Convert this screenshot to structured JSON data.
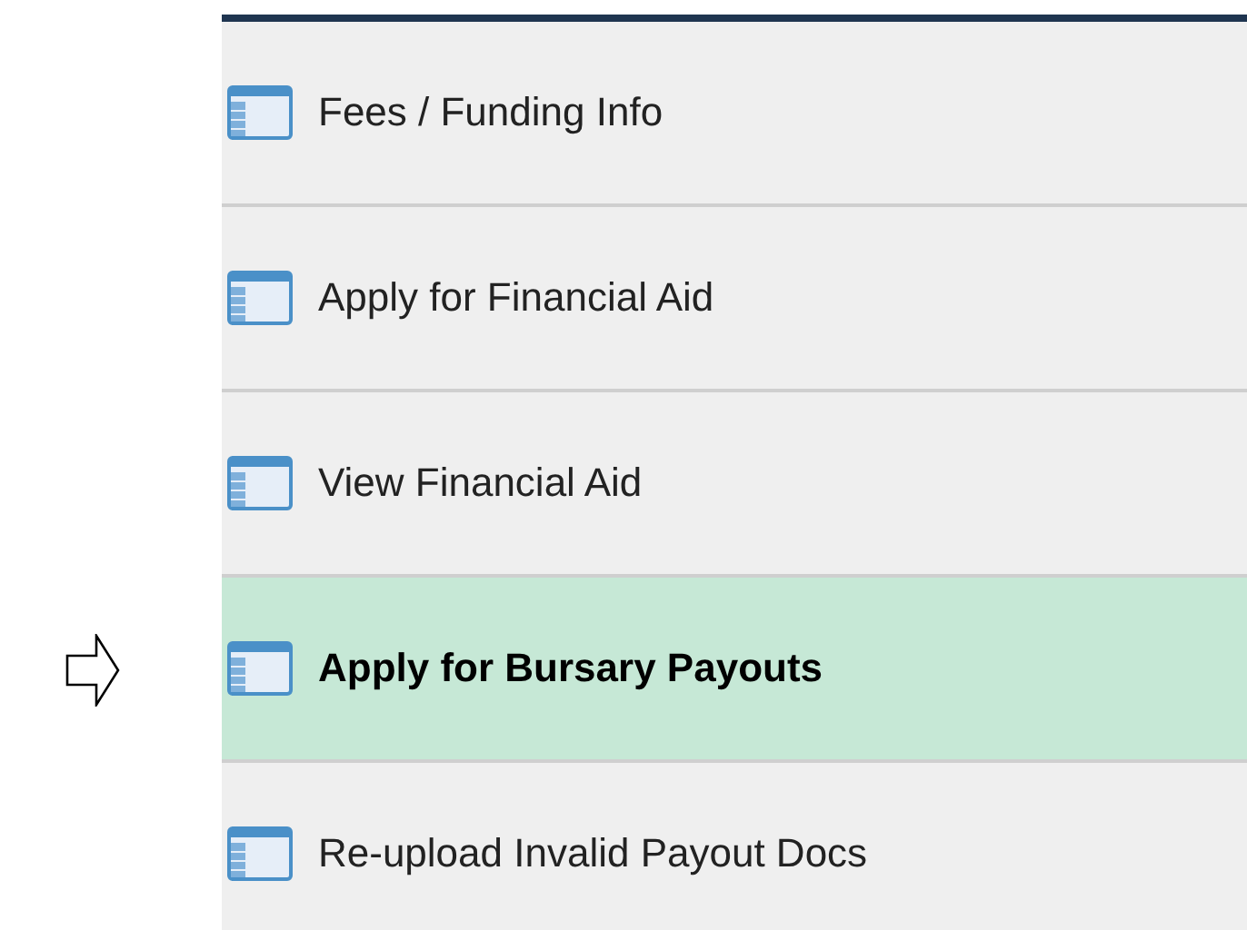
{
  "menu": {
    "items": [
      {
        "label": "Fees / Funding Info",
        "selected": false,
        "pointed": false
      },
      {
        "label": "Apply for Financial Aid",
        "selected": false,
        "pointed": false
      },
      {
        "label": "View Financial Aid",
        "selected": false,
        "pointed": false
      },
      {
        "label": "Apply for Bursary Payouts",
        "selected": true,
        "pointed": true
      },
      {
        "label": "Re-upload Invalid Payout Docs",
        "selected": false,
        "pointed": false
      }
    ]
  }
}
